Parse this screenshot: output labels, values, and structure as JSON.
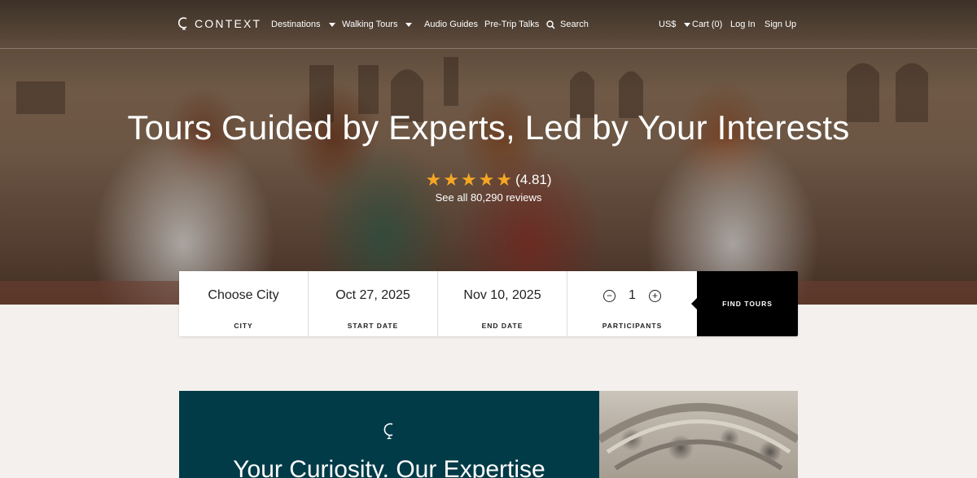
{
  "nav": {
    "logo_text": "CONTEXT",
    "items": [
      {
        "label": "Destinations",
        "has_caret": true
      },
      {
        "label": "Walking Tours",
        "has_caret": true
      },
      {
        "label": "Audio Guides",
        "has_caret": false
      },
      {
        "label": "Pre-Trip Talks",
        "has_caret": false
      },
      {
        "label": "Search",
        "icon": "search-icon"
      }
    ],
    "currency": "US$",
    "cart": "Cart (0)",
    "login": "Log In",
    "signup": "Sign Up"
  },
  "hero": {
    "title": "Tours Guided by Experts, Led by Your Interests",
    "rating_value": "(4.81)",
    "stars": 5,
    "reviews_link": "See all 80,290 reviews"
  },
  "search": {
    "city": {
      "value": "Choose City",
      "label": "CITY"
    },
    "start_date": {
      "value": "Oct 27, 2025",
      "label": "START DATE"
    },
    "end_date": {
      "value": "Nov 10, 2025",
      "label": "END DATE"
    },
    "participants": {
      "value": "1",
      "label": "PARTICIPANTS",
      "minus": "−",
      "plus": "+"
    },
    "find_button": "FIND TOURS"
  },
  "promo": {
    "heading": "Your Curiosity. Our Expertise"
  },
  "colors": {
    "accent_star": "#f5a623",
    "promo_bg": "#003b47",
    "find_button_bg": "#000000",
    "page_bg": "#f3f0ed"
  }
}
